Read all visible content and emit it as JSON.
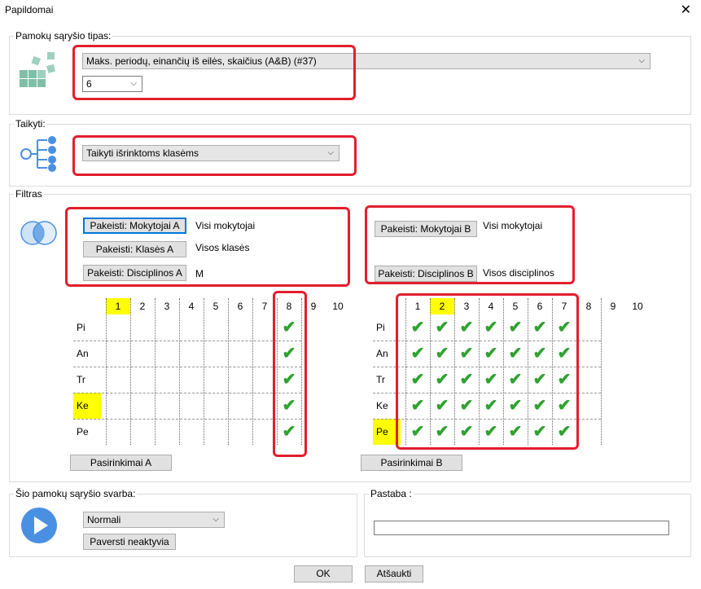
{
  "window": {
    "title": "Papildomai",
    "close_glyph": "✕"
  },
  "relation_type": {
    "legend": "Pamokų sąryšio tipas:",
    "selected": "Maks. periodų, einančių iš eilės, skaičius (A&B) (#37)",
    "count_value": "6"
  },
  "apply": {
    "legend": "Taikyti:",
    "selected": "Taikyti išrinktoms klasėms"
  },
  "filter": {
    "legend": "Filtras",
    "a": {
      "teachers_button": "Pakeisti: Mokytojai A",
      "teachers_value": "Visi mokytojai",
      "classes_button": "Pakeisti: Klasės A",
      "classes_value": "Visos klasės",
      "subjects_button": "Pakeisti: Disciplinos A",
      "subjects_value": "M",
      "choices_button": "Pasirinkimai A"
    },
    "b": {
      "teachers_button": "Pakeisti: Mokytojai B",
      "teachers_value": "Visi mokytojai",
      "subjects_button": "Pakeisti: Disciplinos B",
      "subjects_value": "Visos disciplinos",
      "choices_button": "Pasirinkimai B"
    }
  },
  "grid_a": {
    "columns": [
      "1",
      "2",
      "3",
      "4",
      "5",
      "6",
      "7",
      "8",
      "9",
      "10"
    ],
    "rows": [
      "Pi",
      "An",
      "Tr",
      "Ke",
      "Pe"
    ],
    "highlight_col": 0,
    "highlight_row": 3,
    "checked_cols": [
      7
    ]
  },
  "grid_b": {
    "columns": [
      "1",
      "2",
      "3",
      "4",
      "5",
      "6",
      "7",
      "8",
      "9",
      "10"
    ],
    "rows": [
      "Pi",
      "An",
      "Tr",
      "Ke",
      "Pe"
    ],
    "highlight_col": 1,
    "highlight_row": 4,
    "checked_cols": [
      0,
      1,
      2,
      3,
      4,
      5,
      6
    ]
  },
  "importance": {
    "legend": "Šio pamokų sąryšio svarba:",
    "selected": "Normali",
    "deactivate_button": "Paversti neaktyvia"
  },
  "note": {
    "legend": "Pastaba :",
    "value": ""
  },
  "footer": {
    "ok": "OK",
    "cancel": "Atšaukti"
  },
  "icons": {
    "check": "✔",
    "chevron": "⌵"
  },
  "colors": {
    "highlight": "#ffff00",
    "check": "#2fa22f",
    "annotation": "#e21e2d",
    "play": "#4a90e2"
  }
}
